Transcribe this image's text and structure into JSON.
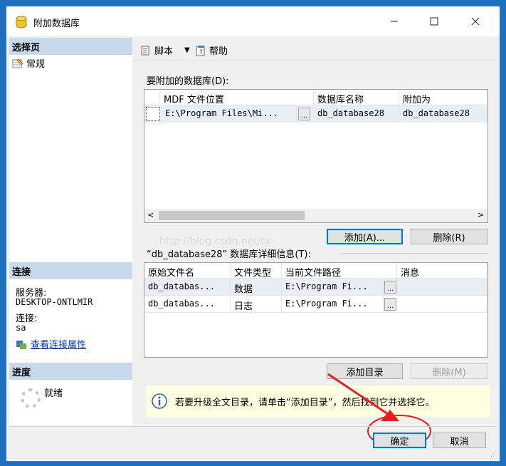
{
  "window": {
    "title": "附加数据库",
    "min_icon": "minimize-icon",
    "max_icon": "maximize-icon",
    "close_icon": "close-icon"
  },
  "left_pane": {
    "select_page_header": "选择页",
    "pages": [
      {
        "label": "常规",
        "icon": "general-page-icon"
      }
    ],
    "connection_header": "连接",
    "server_label": "服务器:",
    "server_value": "DESKTOP-ONTLMIR",
    "connection_label": "连接:",
    "connection_value": "sa",
    "view_props_link": "查看连接属性",
    "progress_header": "进度",
    "progress_status": "就绪"
  },
  "toolbar": {
    "script_label": "脚本",
    "help_label": "帮助"
  },
  "databases_section": {
    "label": "要附加的数据库(D):",
    "columns": [
      "MDF 文件位置",
      "数据库名称",
      "附加为"
    ],
    "rows": [
      {
        "mdf": "E:\\Program Files\\Mi...",
        "db_name": "db_database28",
        "attach_as": "db_database28"
      }
    ],
    "add_button": "添加(A)...",
    "remove_button": "删除(R)"
  },
  "details_section": {
    "label": "“db_database28” 数据库详细信息(T):",
    "columns": [
      "原始文件名",
      "文件类型",
      "当前文件路径",
      "消息"
    ],
    "rows": [
      {
        "name": "db_databas...",
        "type": "数据",
        "path": "E:\\Program Fi..."
      },
      {
        "name": "db_databas...",
        "type": "日志",
        "path": "E:\\Program Fi..."
      }
    ],
    "add_catalog_button": "添加目录",
    "remove_button": "删除(M)"
  },
  "info": {
    "text": "若要升级全文目录，请单击“添加目录”，然后找到它并选择它。"
  },
  "footer": {
    "ok_button": "确定",
    "cancel_button": "取消"
  },
  "watermark": "http://blog.csdn.net/tx"
}
